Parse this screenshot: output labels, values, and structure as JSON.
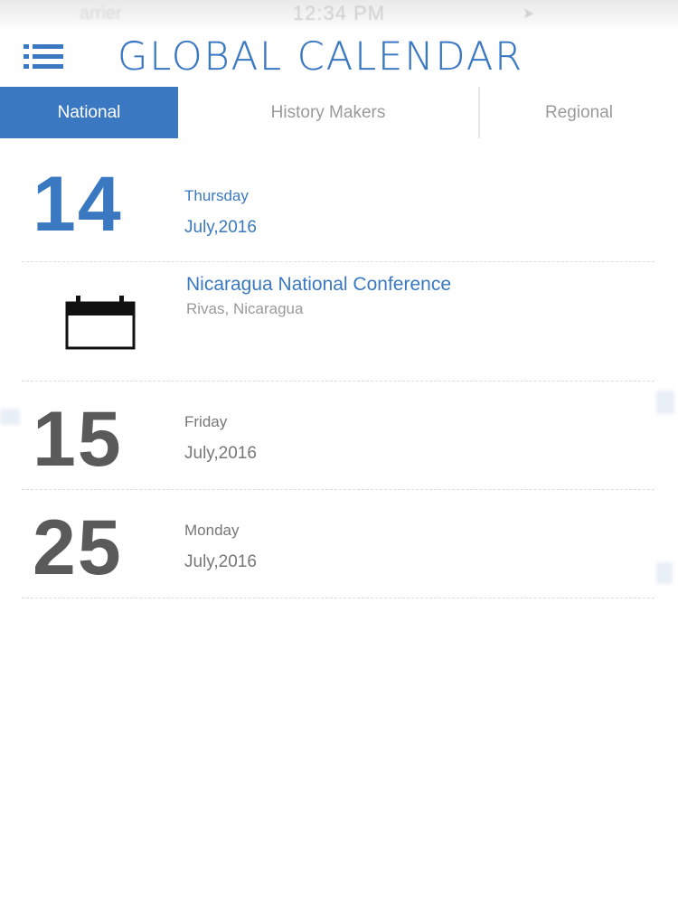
{
  "status_bar": {
    "carrier": "arrier",
    "time": "12:34 PM",
    "location_icon": "location-arrow-icon"
  },
  "header": {
    "title": "GLOBAL CALENDAR",
    "menu_icon": "menu-list-icon"
  },
  "tabs": [
    {
      "label": "National",
      "active": true
    },
    {
      "label": "History Makers",
      "active": false
    },
    {
      "label": "Regional",
      "active": false
    }
  ],
  "entries": [
    {
      "day": "14",
      "weekday": "Thursday",
      "month_year": "July,2016",
      "highlight": true,
      "events": [
        {
          "title": "Nicaragua National Conference",
          "location": "Rivas, Nicaragua",
          "icon": "calendar-icon"
        }
      ]
    },
    {
      "day": "15",
      "weekday": "Friday",
      "month_year": "July,2016",
      "highlight": false,
      "events": []
    },
    {
      "day": "25",
      "weekday": "Monday",
      "month_year": "July,2016",
      "highlight": false,
      "events": []
    }
  ],
  "colors": {
    "accent": "#3a78c2",
    "text_dark": "#5a5a5a",
    "text_muted": "#9a9a9a",
    "divider": "#dcdcdc"
  }
}
